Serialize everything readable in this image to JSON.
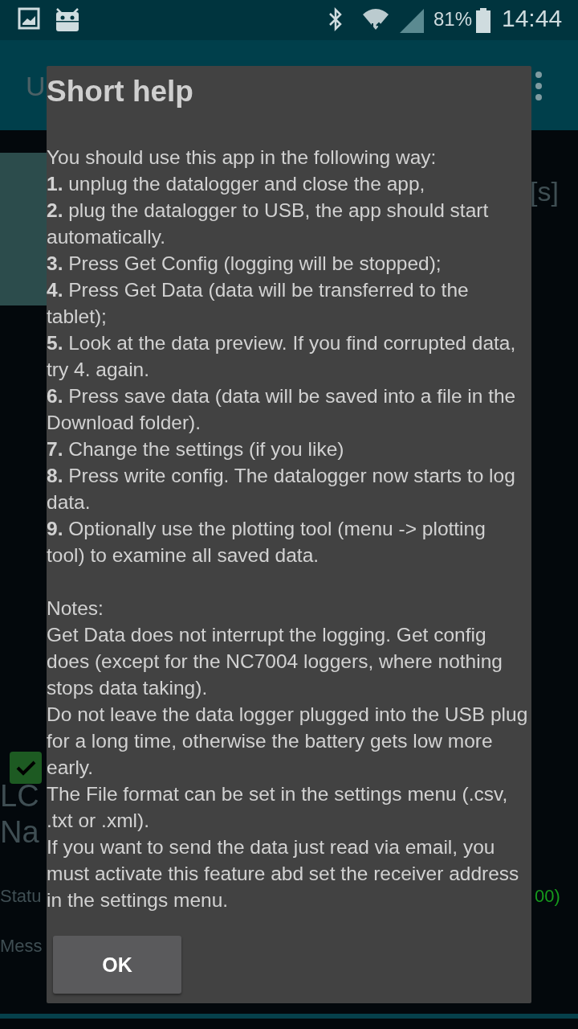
{
  "status_bar": {
    "battery": "81%",
    "time": "14:44"
  },
  "app_bar": {
    "title": "U"
  },
  "background": {
    "unit_label": "[s]",
    "checkbox": {
      "checked": true
    },
    "label_1": "LC",
    "label_2": "Na",
    "status_label": "Statu",
    "status_value": "00)",
    "message_label": "Mess"
  },
  "dialog": {
    "title": "Short help",
    "intro": "You should use this app in the following way:",
    "steps": [
      "**1.** unplug the datalogger and close the app,",
      "**2.** plug the datalogger to USB, the app should start automatically.",
      "**3.** Press Get Config (logging will be stopped);",
      "**4.** Press Get Data (data will be transferred to the tablet);",
      "**5.** Look at the data preview. If you find corrupted data, try 4. again.",
      "**6.** Press save data (data will be saved into a file in the Download folder).",
      "**7.** Change the settings (if you like)",
      "**8.** Press write config. The datalogger now starts to log data.",
      "**9.** Optionally use the plotting tool (menu -> plotting tool) to examine all saved data."
    ],
    "notes_title": "Notes:",
    "notes": [
      "Get Data does not interrupt the logging. Get config does (except for the NC7004 loggers, where nothing stops data taking).",
      "Do not leave the data logger plugged into the USB plug for a long time, otherwise the battery gets low more early.",
      "The File format can be set in the settings menu (.csv, .txt or .xml).",
      "If you want to send the data just read via email, you must activate this feature abd set the receiver address in the settings menu."
    ],
    "button": "OK"
  }
}
